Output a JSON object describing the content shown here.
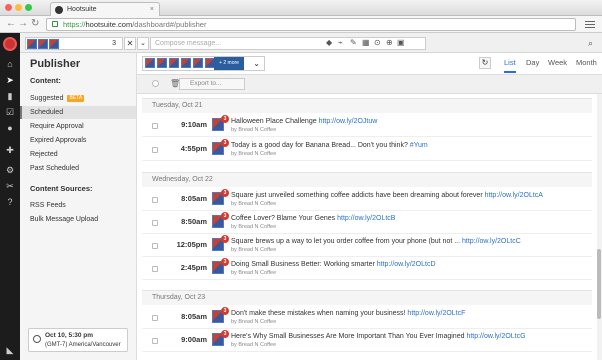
{
  "browser": {
    "tab_title": "Hootsuite",
    "url_https": "https://",
    "url_host": "hootsuite.com",
    "url_path": "/dashboard#/publisher"
  },
  "topbar": {
    "profile_count": "3",
    "compose_placeholder": "Compose message..."
  },
  "sidebar": {
    "title": "Publisher",
    "content_heading": "Content:",
    "items": [
      {
        "label": "Suggested",
        "badge": "BETA"
      },
      {
        "label": "Scheduled"
      },
      {
        "label": "Require Approval"
      },
      {
        "label": "Expired Approvals"
      },
      {
        "label": "Rejected"
      },
      {
        "label": "Past Scheduled"
      }
    ],
    "sources_heading": "Content Sources:",
    "sources": [
      "RSS Feeds",
      "Bulk Message Upload"
    ],
    "timezone_time": "Oct 10, 5:30 pm",
    "timezone_name": "(GMT-7) America/Vancouver"
  },
  "controls": {
    "more_label": "+ 2 more",
    "views": [
      "List",
      "Day",
      "Week",
      "Month"
    ],
    "active_view": "List",
    "export_placeholder": "Export to..."
  },
  "days": [
    {
      "date": "Tuesday, Oct 21",
      "posts": [
        {
          "time": "9:10am",
          "badge": "3",
          "text": "Halloween Place Challenge ",
          "link": "http://ow.ly/2OJtuw",
          "by": "by Bread N Coffee"
        },
        {
          "time": "4:55pm",
          "badge": "3",
          "text": "Today is a good day for Banana Bread... Don't you think? ",
          "link": "#Yum",
          "by": "by Bread N Coffee"
        }
      ]
    },
    {
      "date": "Wednesday, Oct 22",
      "posts": [
        {
          "time": "8:05am",
          "badge": "3",
          "text": "Square just unveiled something coffee addicts have been dreaming about forever ",
          "link": "http://ow.ly/2OLtcA",
          "by": "by Bread N Coffee"
        },
        {
          "time": "8:50am",
          "badge": "3",
          "text": "Coffee Lover? Blame Your Genes ",
          "link": "http://ow.ly/2OLtcB",
          "by": "by Bread N Coffee"
        },
        {
          "time": "12:05pm",
          "badge": "3",
          "text": "Square brews up a way to let you order coffee from your phone (but not ... ",
          "link": "http://ow.ly/2OLtcC",
          "by": "by Bread N Coffee"
        },
        {
          "time": "2:45pm",
          "badge": "3",
          "text": "Doing Small Business Better: Working smarter ",
          "link": "http://ow.ly/2OLtcD",
          "by": "by Bread N Coffee"
        }
      ]
    },
    {
      "date": "Thursday, Oct 23",
      "posts": [
        {
          "time": "8:05am",
          "badge": "3",
          "text": "Don't make these mistakes when naming your business! ",
          "link": "http://ow.ly/2OLtcF",
          "by": "by Bread N Coffee"
        },
        {
          "time": "9:00am",
          "badge": "3",
          "text": "Here's Why Small Businesses Are More Important Than You Ever Imagined ",
          "link": "http://ow.ly/2OLtcG",
          "by": "by Bread N Coffee"
        }
      ]
    }
  ]
}
